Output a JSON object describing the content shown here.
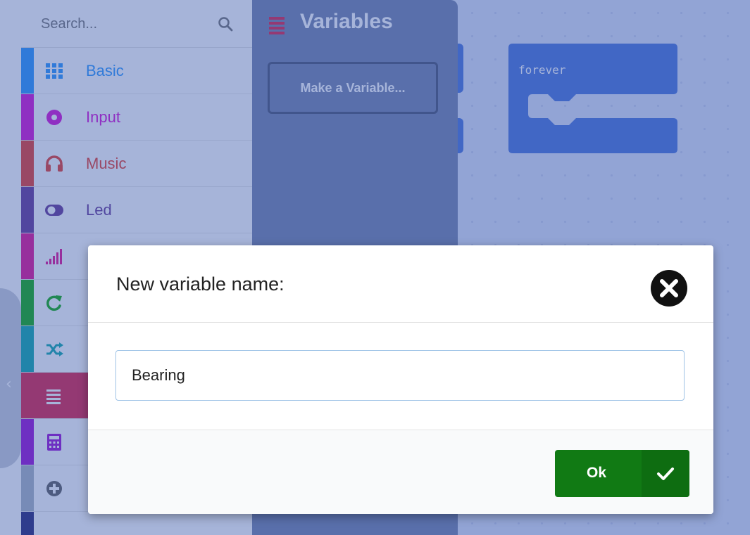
{
  "sidebar": {
    "search_placeholder": "Search...",
    "categories": [
      {
        "label": "Basic",
        "color": "#1e90ff",
        "icon": "grid-icon"
      },
      {
        "label": "Input",
        "color": "#d400d4",
        "icon": "circle-dot-icon"
      },
      {
        "label": "Music",
        "color": "#e63022",
        "icon": "headphones-icon"
      },
      {
        "label": "Led",
        "color": "#5c2d91",
        "icon": "toggle-icon"
      },
      {
        "label": "",
        "color": "#e3008c",
        "icon": "signal-bars-icon"
      },
      {
        "label": "",
        "color": "#00aa00",
        "icon": "loop-arrow-icon"
      },
      {
        "label": "",
        "color": "#00a4a6",
        "icon": "shuffle-icon"
      },
      {
        "label": "",
        "color": "#dc143c",
        "icon": "lines-icon"
      },
      {
        "label": "",
        "color": "#9400d3",
        "icon": "calculator-icon"
      },
      {
        "label": "",
        "color": "#a5b1be",
        "icon": "plus-circle-icon"
      }
    ]
  },
  "flyout": {
    "title": "Variables",
    "make_variable_label": "Make a Variable..."
  },
  "workspace": {
    "forever_label": "forever"
  },
  "dialog": {
    "title": "New variable name:",
    "input_value": "Bearing",
    "ok_label": "Ok"
  },
  "colors": {
    "ok_green": "#117a14",
    "variables_magenta": "#dc143c",
    "block_blue": "#3f6bd9"
  }
}
